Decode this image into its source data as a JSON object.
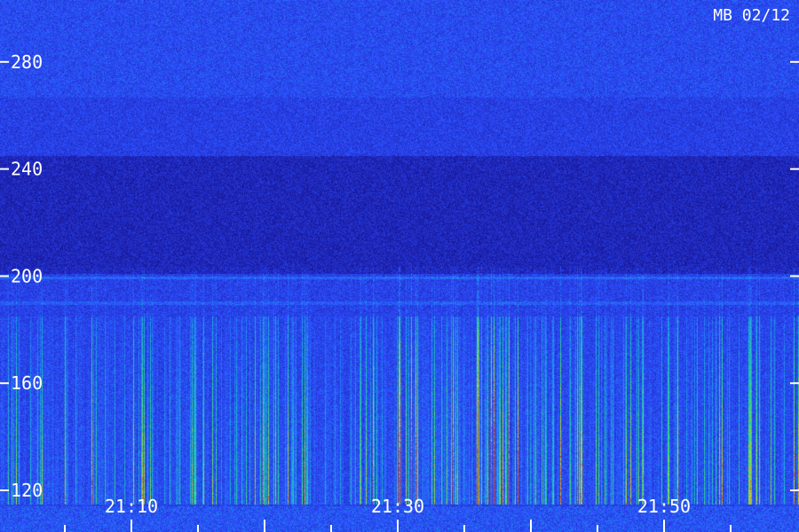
{
  "stamp": "MB 02/12",
  "chart_data": {
    "type": "heatmap",
    "title": "",
    "xlabel": "",
    "ylabel": "",
    "y_ticks": [
      "280",
      "240",
      "200",
      "160",
      "120"
    ],
    "y_tick_values": [
      280,
      240,
      200,
      160,
      120
    ],
    "x_ticks": [
      "21:10",
      "21:30",
      "21:50"
    ],
    "x_tick_values": [
      "21:10",
      "21:30",
      "21:50"
    ],
    "xlim": [
      "21:00",
      "21:59"
    ],
    "ylim": [
      107,
      292
    ],
    "colormap": [
      "#000033",
      "#1a1aa0",
      "#2d4dff",
      "#19a8e0",
      "#2fe07a",
      "#d0e020",
      "#e04020"
    ],
    "features": {
      "noise_floor_band": [
        107,
        292
      ],
      "dark_band": [
        200,
        245
      ],
      "bright_line_y": 200,
      "active_band": [
        115,
        185
      ],
      "peak_activity_time": "21:35"
    }
  }
}
